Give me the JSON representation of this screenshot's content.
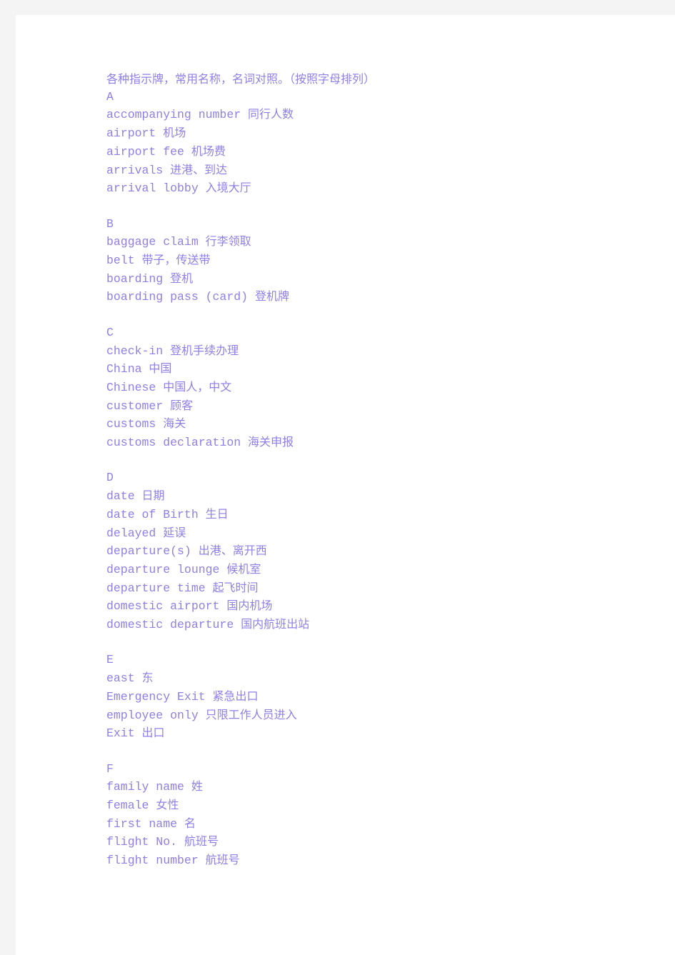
{
  "document": {
    "title_line": "各种指示牌，常用名称，名词对照。（按照字母排列）",
    "text_color": "#8f7fe8",
    "page_background": "#ffffff",
    "canvas_background": "#f4f4f4",
    "lines": [
      {
        "kind": "title",
        "text": "各种指示牌，常用名称，名词对照。（按照字母排列）"
      },
      {
        "kind": "letter",
        "text": "A"
      },
      {
        "kind": "entry",
        "term": "accompanying number",
        "gloss": "同行人数"
      },
      {
        "kind": "entry",
        "term": "airport",
        "gloss": "机场"
      },
      {
        "kind": "entry",
        "term": "airport fee",
        "gloss": "机场费"
      },
      {
        "kind": "entry",
        "term": "arrivals",
        "gloss": "进港、到达"
      },
      {
        "kind": "entry",
        "term": "arrival lobby",
        "gloss": "入境大厅"
      },
      {
        "kind": "blank",
        "text": ""
      },
      {
        "kind": "letter",
        "text": "B"
      },
      {
        "kind": "entry",
        "term": "baggage claim",
        "gloss": "行李领取"
      },
      {
        "kind": "entry",
        "term": "belt",
        "gloss": "带子，传送带"
      },
      {
        "kind": "entry",
        "term": "boarding",
        "gloss": "登机"
      },
      {
        "kind": "entry",
        "term": "boarding pass (card)",
        "gloss": "登机牌"
      },
      {
        "kind": "blank",
        "text": ""
      },
      {
        "kind": "letter",
        "text": "C"
      },
      {
        "kind": "entry",
        "term": "check-in",
        "gloss": "登机手续办理"
      },
      {
        "kind": "entry",
        "term": "China",
        "gloss": "中国"
      },
      {
        "kind": "entry",
        "term": "Chinese",
        "gloss": "中国人，中文"
      },
      {
        "kind": "entry",
        "term": "customer",
        "gloss": "顾客"
      },
      {
        "kind": "entry",
        "term": "customs",
        "gloss": "海关"
      },
      {
        "kind": "entry",
        "term": "customs declaration",
        "gloss": "海关申报"
      },
      {
        "kind": "blank",
        "text": ""
      },
      {
        "kind": "letter",
        "text": "D"
      },
      {
        "kind": "entry",
        "term": "date",
        "gloss": "日期"
      },
      {
        "kind": "entry",
        "term": "date of Birth",
        "gloss": "生日"
      },
      {
        "kind": "entry",
        "term": "delayed",
        "gloss": "延误"
      },
      {
        "kind": "entry",
        "term": "departure(s)",
        "gloss": "出港、离开西"
      },
      {
        "kind": "entry",
        "term": "departure lounge",
        "gloss": "候机室"
      },
      {
        "kind": "entry",
        "term": "departure time",
        "gloss": "起飞时间"
      },
      {
        "kind": "entry",
        "term": "domestic airport",
        "gloss": "国内机场"
      },
      {
        "kind": "entry",
        "term": "domestic departure",
        "gloss": "国内航班出站"
      },
      {
        "kind": "blank",
        "text": ""
      },
      {
        "kind": "letter",
        "text": "E"
      },
      {
        "kind": "entry",
        "term": "east",
        "gloss": "东"
      },
      {
        "kind": "entry",
        "term": "Emergency Exit",
        "gloss": "紧急出口"
      },
      {
        "kind": "entry",
        "term": "employee only",
        "gloss": "只限工作人员进入"
      },
      {
        "kind": "entry",
        "term": "Exit",
        "gloss": "出口"
      },
      {
        "kind": "blank",
        "text": ""
      },
      {
        "kind": "letter",
        "text": "F"
      },
      {
        "kind": "entry",
        "term": "family name",
        "gloss": "姓"
      },
      {
        "kind": "entry",
        "term": "female",
        "gloss": "女性"
      },
      {
        "kind": "entry",
        "term": "first name",
        "gloss": "名"
      },
      {
        "kind": "entry",
        "term": "flight No.",
        "gloss": "航班号"
      },
      {
        "kind": "entry",
        "term": "flight number",
        "gloss": "航班号"
      }
    ]
  }
}
